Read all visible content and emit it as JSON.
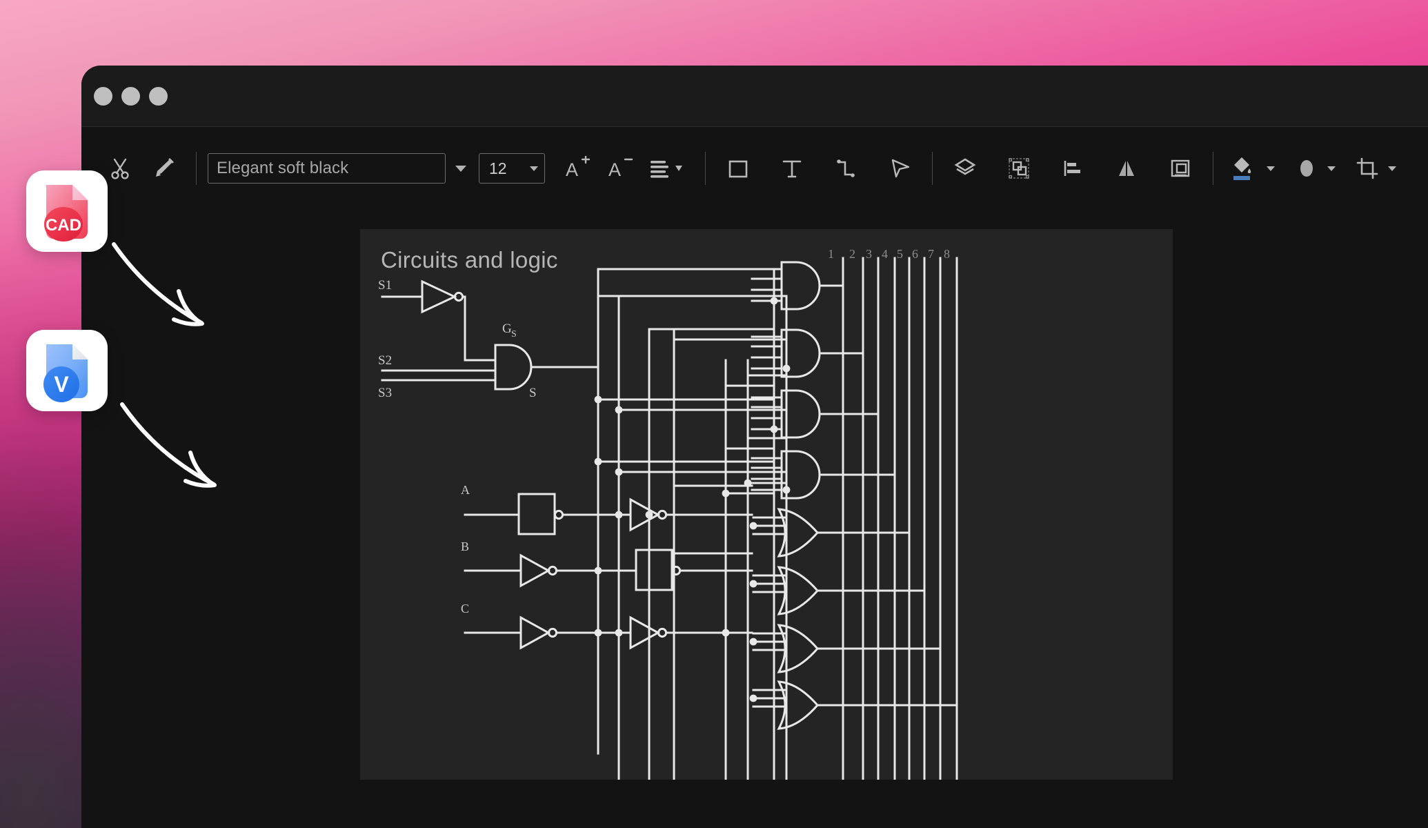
{
  "background": {
    "gradient_from": "#f7a8c4",
    "gradient_mid": "#e01f8f",
    "gradient_to": "#9b19dd"
  },
  "window": {
    "background": "#131313",
    "titlebar_background": "#1b1b1b",
    "traffic_lights": [
      {
        "name": "close",
        "color": "#bfbfbf"
      },
      {
        "name": "minimize",
        "color": "#bfbfbf"
      },
      {
        "name": "maximize",
        "color": "#bfbfbf"
      }
    ]
  },
  "toolbar": {
    "cut_label": "Cut",
    "format_painter_label": "Format Painter",
    "font_name": {
      "value": "Elegant soft black",
      "placeholder": "Elegant soft black"
    },
    "font_size": {
      "value": "12"
    },
    "grow_font_label": "Increase Font Size",
    "shrink_font_label": "Decrease Font Size",
    "paragraph_label": "Paragraph",
    "shape_label": "Rectangle",
    "text_label": "Text Box",
    "connector_label": "Connector",
    "pointer_label": "Pointer Tool",
    "layers_label": "Layers",
    "group_label": "Group",
    "align_label": "Align",
    "flip_label": "Flip",
    "position_label": "Position",
    "fill_label": "Fill Color",
    "line_label": "Line Style",
    "crop_label": "Crop",
    "icons": [
      "scissors-icon",
      "format-painter-icon",
      "chevron-down-icon",
      "font-grow-icon",
      "font-shrink-icon",
      "paragraph-align-icon",
      "rectangle-icon",
      "text-box-icon",
      "connector-icon",
      "pointer-icon",
      "layers-icon",
      "group-icon",
      "align-left-icon",
      "flip-icon",
      "position-icon",
      "fill-bucket-icon",
      "shape-outline-icon",
      "crop-icon"
    ],
    "fill_swatch_color": "#4a7ebb"
  },
  "canvas": {
    "background": "#242424",
    "title": "Circuits and logic"
  },
  "file_badges": [
    {
      "name": "cad-file",
      "label": "CAD",
      "color_primary": "#ef4056",
      "color_secondary": "#f591b0",
      "badge_background": "#ffffff"
    },
    {
      "name": "vsd-file",
      "label": "V",
      "color_primary": "#2b7cf0",
      "color_secondary": "#84b4f7",
      "badge_background": "#ffffff"
    }
  ],
  "diagram": {
    "wire_color": "#e8e8e8",
    "pin_numbers": [
      "1",
      "2",
      "3",
      "4",
      "5",
      "6",
      "7",
      "8"
    ],
    "signal_labels": [
      {
        "name": "s1",
        "text": "S1"
      },
      {
        "name": "s2",
        "text": "S2"
      },
      {
        "name": "s3",
        "text": "S3"
      },
      {
        "name": "gs",
        "text": "G"
      },
      {
        "name": "gs-sub",
        "text": "S"
      },
      {
        "name": "s-out",
        "text": "S"
      },
      {
        "name": "a",
        "text": "A"
      },
      {
        "name": "b",
        "text": "B"
      },
      {
        "name": "c",
        "text": "C"
      }
    ],
    "gates": [
      {
        "name": "not-gate-s1",
        "type": "NOT",
        "inputs": [
          "S1"
        ]
      },
      {
        "name": "and-gate-gs",
        "type": "AND",
        "label": "Gs",
        "inputs": [
          "/S1",
          "S2",
          "S3"
        ],
        "output": "S"
      },
      {
        "name": "and-gate-1",
        "type": "AND",
        "output_pin": "1"
      },
      {
        "name": "and-gate-2",
        "type": "AND",
        "output_pin": "2"
      },
      {
        "name": "and-gate-3",
        "type": "AND",
        "output_pin": "3"
      },
      {
        "name": "and-gate-4",
        "type": "AND",
        "output_pin": "4"
      },
      {
        "name": "or-gate-5",
        "type": "OR",
        "output_pin": "5"
      },
      {
        "name": "or-gate-6",
        "type": "OR",
        "output_pin": "6"
      },
      {
        "name": "or-gate-7",
        "type": "OR",
        "output_pin": "7"
      },
      {
        "name": "or-gate-8",
        "type": "OR",
        "output_pin": "8"
      },
      {
        "name": "buffer-a",
        "type": "BUFFER-BOX",
        "inputs": [
          "A"
        ]
      },
      {
        "name": "not-gate-a2",
        "type": "NOT",
        "inputs": [
          "A"
        ]
      },
      {
        "name": "not-gate-b",
        "type": "NOT",
        "inputs": [
          "B"
        ]
      },
      {
        "name": "buffer-b",
        "type": "BUFFER-BOX",
        "inputs": [
          "B"
        ]
      },
      {
        "name": "not-gate-c",
        "type": "NOT",
        "inputs": [
          "C"
        ]
      },
      {
        "name": "not-gate-c2",
        "type": "NOT",
        "inputs": [
          "C"
        ]
      }
    ]
  },
  "annotations": [
    {
      "name": "arrow-to-cad",
      "style": "hand-drawn-curve"
    },
    {
      "name": "arrow-to-vsd",
      "style": "hand-drawn-curve"
    }
  ]
}
